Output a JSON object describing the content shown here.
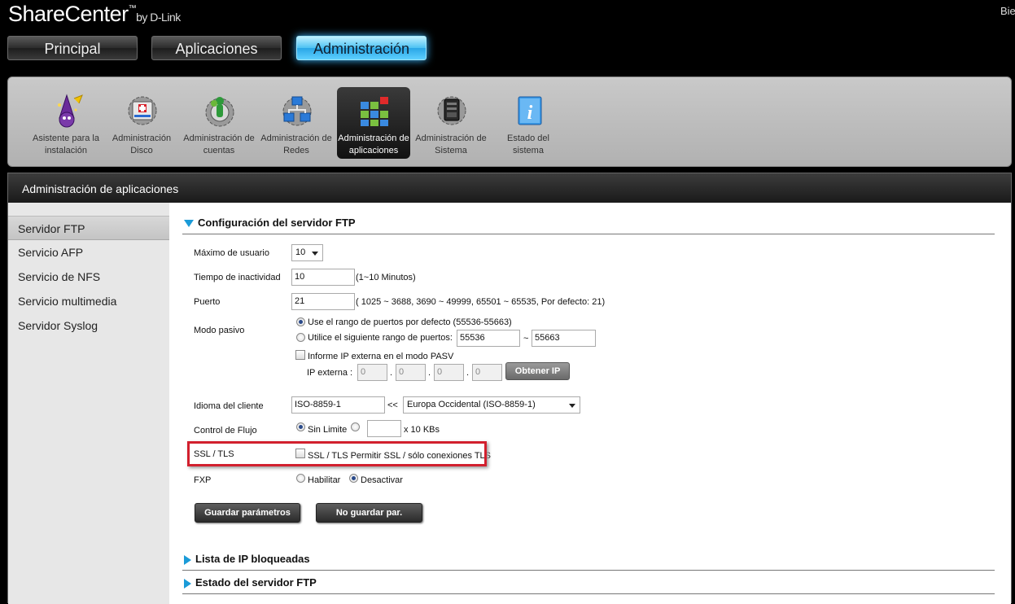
{
  "app": {
    "brand": "ShareCenter",
    "brand_tm": "™",
    "brand_by": "by D-Link",
    "welcome": "Bie"
  },
  "nav": {
    "tabs": [
      {
        "label": "Principal",
        "active": false
      },
      {
        "label": "Aplicaciones",
        "active": false
      },
      {
        "label": "Administración",
        "active": true
      }
    ]
  },
  "toolbar": {
    "items": [
      {
        "label": "Asistente para la instalación",
        "icon": "wizard-icon"
      },
      {
        "label": "Administración Disco",
        "icon": "disk-admin-icon"
      },
      {
        "label": "Administración de cuentas",
        "icon": "accounts-icon"
      },
      {
        "label": "Administración de Redes",
        "icon": "network-icon"
      },
      {
        "label": "Administración de aplicaciones",
        "icon": "apps-icon",
        "active": true
      },
      {
        "label": "Administración de Sistema",
        "icon": "system-icon"
      },
      {
        "label": "Estado del sistema",
        "icon": "info-icon"
      }
    ]
  },
  "panel": {
    "title": "Administración de aplicaciones"
  },
  "sidebar": {
    "items": [
      {
        "label": "Servidor FTP",
        "active": true
      },
      {
        "label": "Servicio AFP"
      },
      {
        "label": "Servicio de NFS"
      },
      {
        "label": "Servicio multimedia"
      },
      {
        "label": "Servidor Syslog"
      }
    ]
  },
  "ftp": {
    "section_title": "Configuración del servidor FTP",
    "max_users": {
      "label": "Máximo de usuario",
      "value": "10"
    },
    "idle": {
      "label": "Tiempo de inactividad",
      "value": "10",
      "hint": "(1~10 Minutos)"
    },
    "port": {
      "label": "Puerto",
      "value": "21",
      "hint": "( 1025 ~ 3688, 3690 ~ 49999, 65501 ~ 65535, Por defecto: 21)"
    },
    "passive": {
      "label": "Modo pasivo",
      "default_range": "Use el rango de puertos por defecto (55536-55663)",
      "custom_range": "Utilice el siguiente rango de puertos:",
      "range_from": "55536",
      "range_sep": "~",
      "range_to": "55663",
      "report_ip": "Informe IP externa en el modo PASV",
      "external_ip_label": "IP externa :",
      "ip": [
        "0",
        "0",
        "0",
        "0"
      ],
      "ip_dot": ".",
      "get_ip_button": "Obtener IP"
    },
    "client_lang": {
      "label": "Idioma del cliente",
      "value": "ISO-8859-1",
      "sep": "<<",
      "option": "Europa Occidental (ISO-8859-1)"
    },
    "flow": {
      "label": "Control de Flujo",
      "unlimited": "Sin Limite",
      "unit": "x 10 KBs",
      "value": ""
    },
    "ssl": {
      "label": "SSL / TLS",
      "option": "SSL / TLS Permitir SSL / sólo conexiones TLS",
      "highlight_color": "#d2202e"
    },
    "fxp": {
      "label": "FXP",
      "enable": "Habilitar",
      "disable": "Desactivar"
    },
    "save_button": "Guardar parámetros",
    "cancel_button": "No guardar par."
  },
  "blocked": {
    "section_title": "Lista de IP bloqueadas"
  },
  "status": {
    "section_title": "Estado del servidor FTP"
  },
  "colors": {
    "accent": "#1b9bd8",
    "active_tab": "#4cc2f3"
  }
}
